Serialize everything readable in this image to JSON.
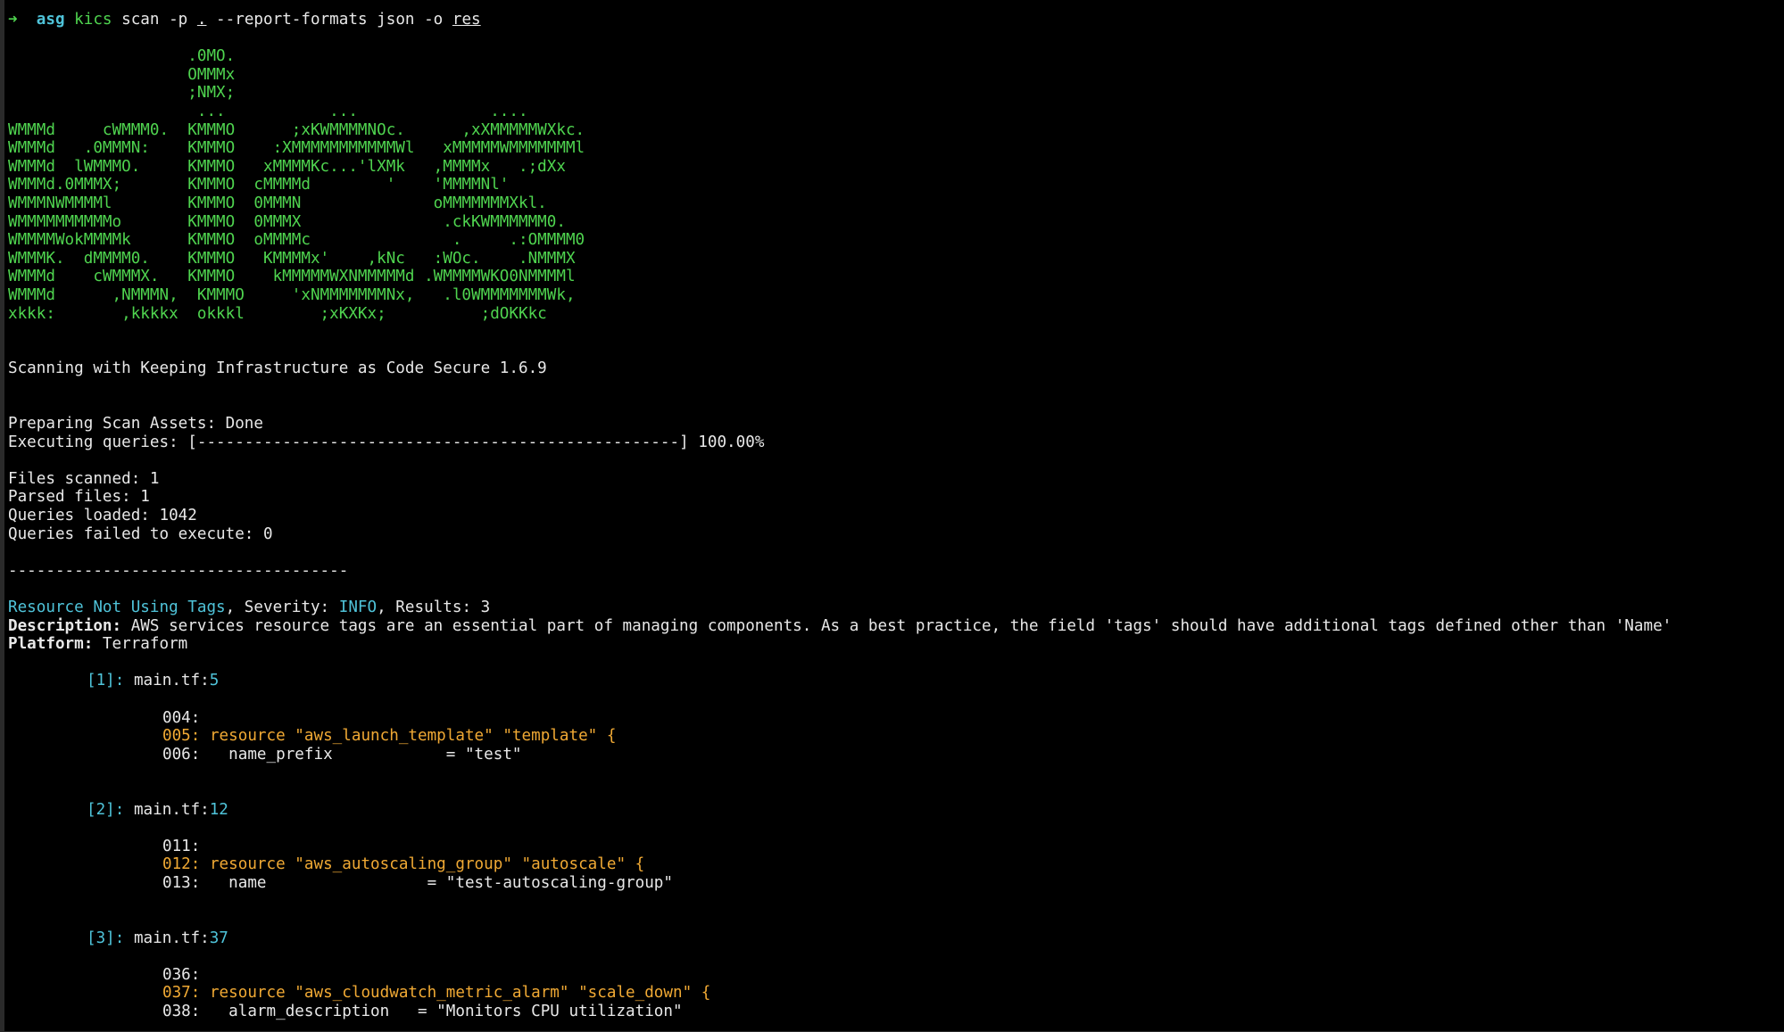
{
  "prompt": {
    "arrow": "➜",
    "dir": "asg",
    "command": "kics",
    "args_before": " scan -p ",
    "path": ".",
    "args_mid": " --report-formats json -o ",
    "output": "res"
  },
  "logo_lines": [
    "                   .0MO.",
    "                   OMMMx",
    "                   ;NMX;",
    "                    ...           ...              ....",
    "WMMMd     cWMMM0.  KMMMO      ;xKWMMMMNOc.      ,xXMMMMMWXkc.",
    "WMMMd   .0MMMN:    KMMMO    :XMMMMMMMMMMMWl   xMMMMMWMMMMMMMl",
    "WMMMd  lWMMMO.     KMMMO   xMMMMKc...'lXMk   ,MMMMx   .;dXx",
    "WMMMd.0MMMX;       KMMMO  cMMMMd        '    'MMMMNl'",
    "WMMMNWMMMMl        KMMMO  0MMMN              oMMMMMMMXkl.",
    "WMMMMMMMMMMo       KMMMO  0MMMX               .ckKWMMMMMM0.",
    "WMMMMWokMMMMk      KMMMO  oMMMMc               .     .:OMMMM0",
    "WMMMK.  dMMMM0.    KMMMO   KMMMMx'    ,kNc   :WOc.    .NMMMX",
    "WMMMd    cWMMMX.   KMMMO    kMMMMMWXNMMMMMd .WMMMMWKO0NMMMMl",
    "WMMMd      ,NMMMN,  KMMMO     'xNMMMMMMMNx,   .l0WMMMMMMMWk,",
    "xkkk:       ,kkkkx  okkkl        ;xKXKx;          ;dOKKkc"
  ],
  "scan_title": "Scanning with Keeping Infrastructure as Code Secure 1.6.9",
  "progress": {
    "preparing": "Preparing Scan Assets: Done",
    "executing_label": "Executing queries: ",
    "bar": "[---------------------------------------------------]",
    "percent": " 100.00%",
    "fraction": 1.0
  },
  "stats": [
    "Files scanned: 1",
    "Parsed files: 1",
    "Queries loaded: 1042",
    "Queries failed to execute: 0"
  ],
  "separator": "------------------------------------",
  "finding": {
    "name": "Resource Not Using Tags",
    "severity_label": ", Severity: ",
    "severity": "INFO",
    "results_label": ", Results: 3",
    "description_label": "Description:",
    "description": " AWS services resource tags are an essential part of managing components. As a best practice, the field 'tags' should have additional tags defined other than 'Name'",
    "platform_label": "Platform:",
    "platform": " Terraform"
  },
  "results": [
    {
      "index": "[1]:",
      "file": " main.tf:",
      "line": "5",
      "snippet": [
        {
          "num": "004:",
          "code": ""
        },
        {
          "num": "005:",
          "code": " resource \"aws_launch_template\" \"template\" {"
        },
        {
          "num": "006:",
          "code": "   name_prefix            = \"test\""
        }
      ]
    },
    {
      "index": "[2]:",
      "file": " main.tf:",
      "line": "12",
      "snippet": [
        {
          "num": "011:",
          "code": ""
        },
        {
          "num": "012:",
          "code": " resource \"aws_autoscaling_group\" \"autoscale\" {"
        },
        {
          "num": "013:",
          "code": "   name                 = \"test-autoscaling-group\""
        }
      ]
    },
    {
      "index": "[3]:",
      "file": " main.tf:",
      "line": "37",
      "snippet": [
        {
          "num": "036:",
          "code": ""
        },
        {
          "num": "037:",
          "code": " resource \"aws_cloudwatch_metric_alarm\" \"scale_down\" {"
        },
        {
          "num": "038:",
          "code": "   alarm_description   = \"Monitors CPU utilization\""
        }
      ]
    }
  ],
  "colors": {
    "background": "#000000",
    "text": "#e8e8e8",
    "green": "#4fd44f",
    "cyan": "#4fc3d9",
    "orange": "#f0a934"
  }
}
